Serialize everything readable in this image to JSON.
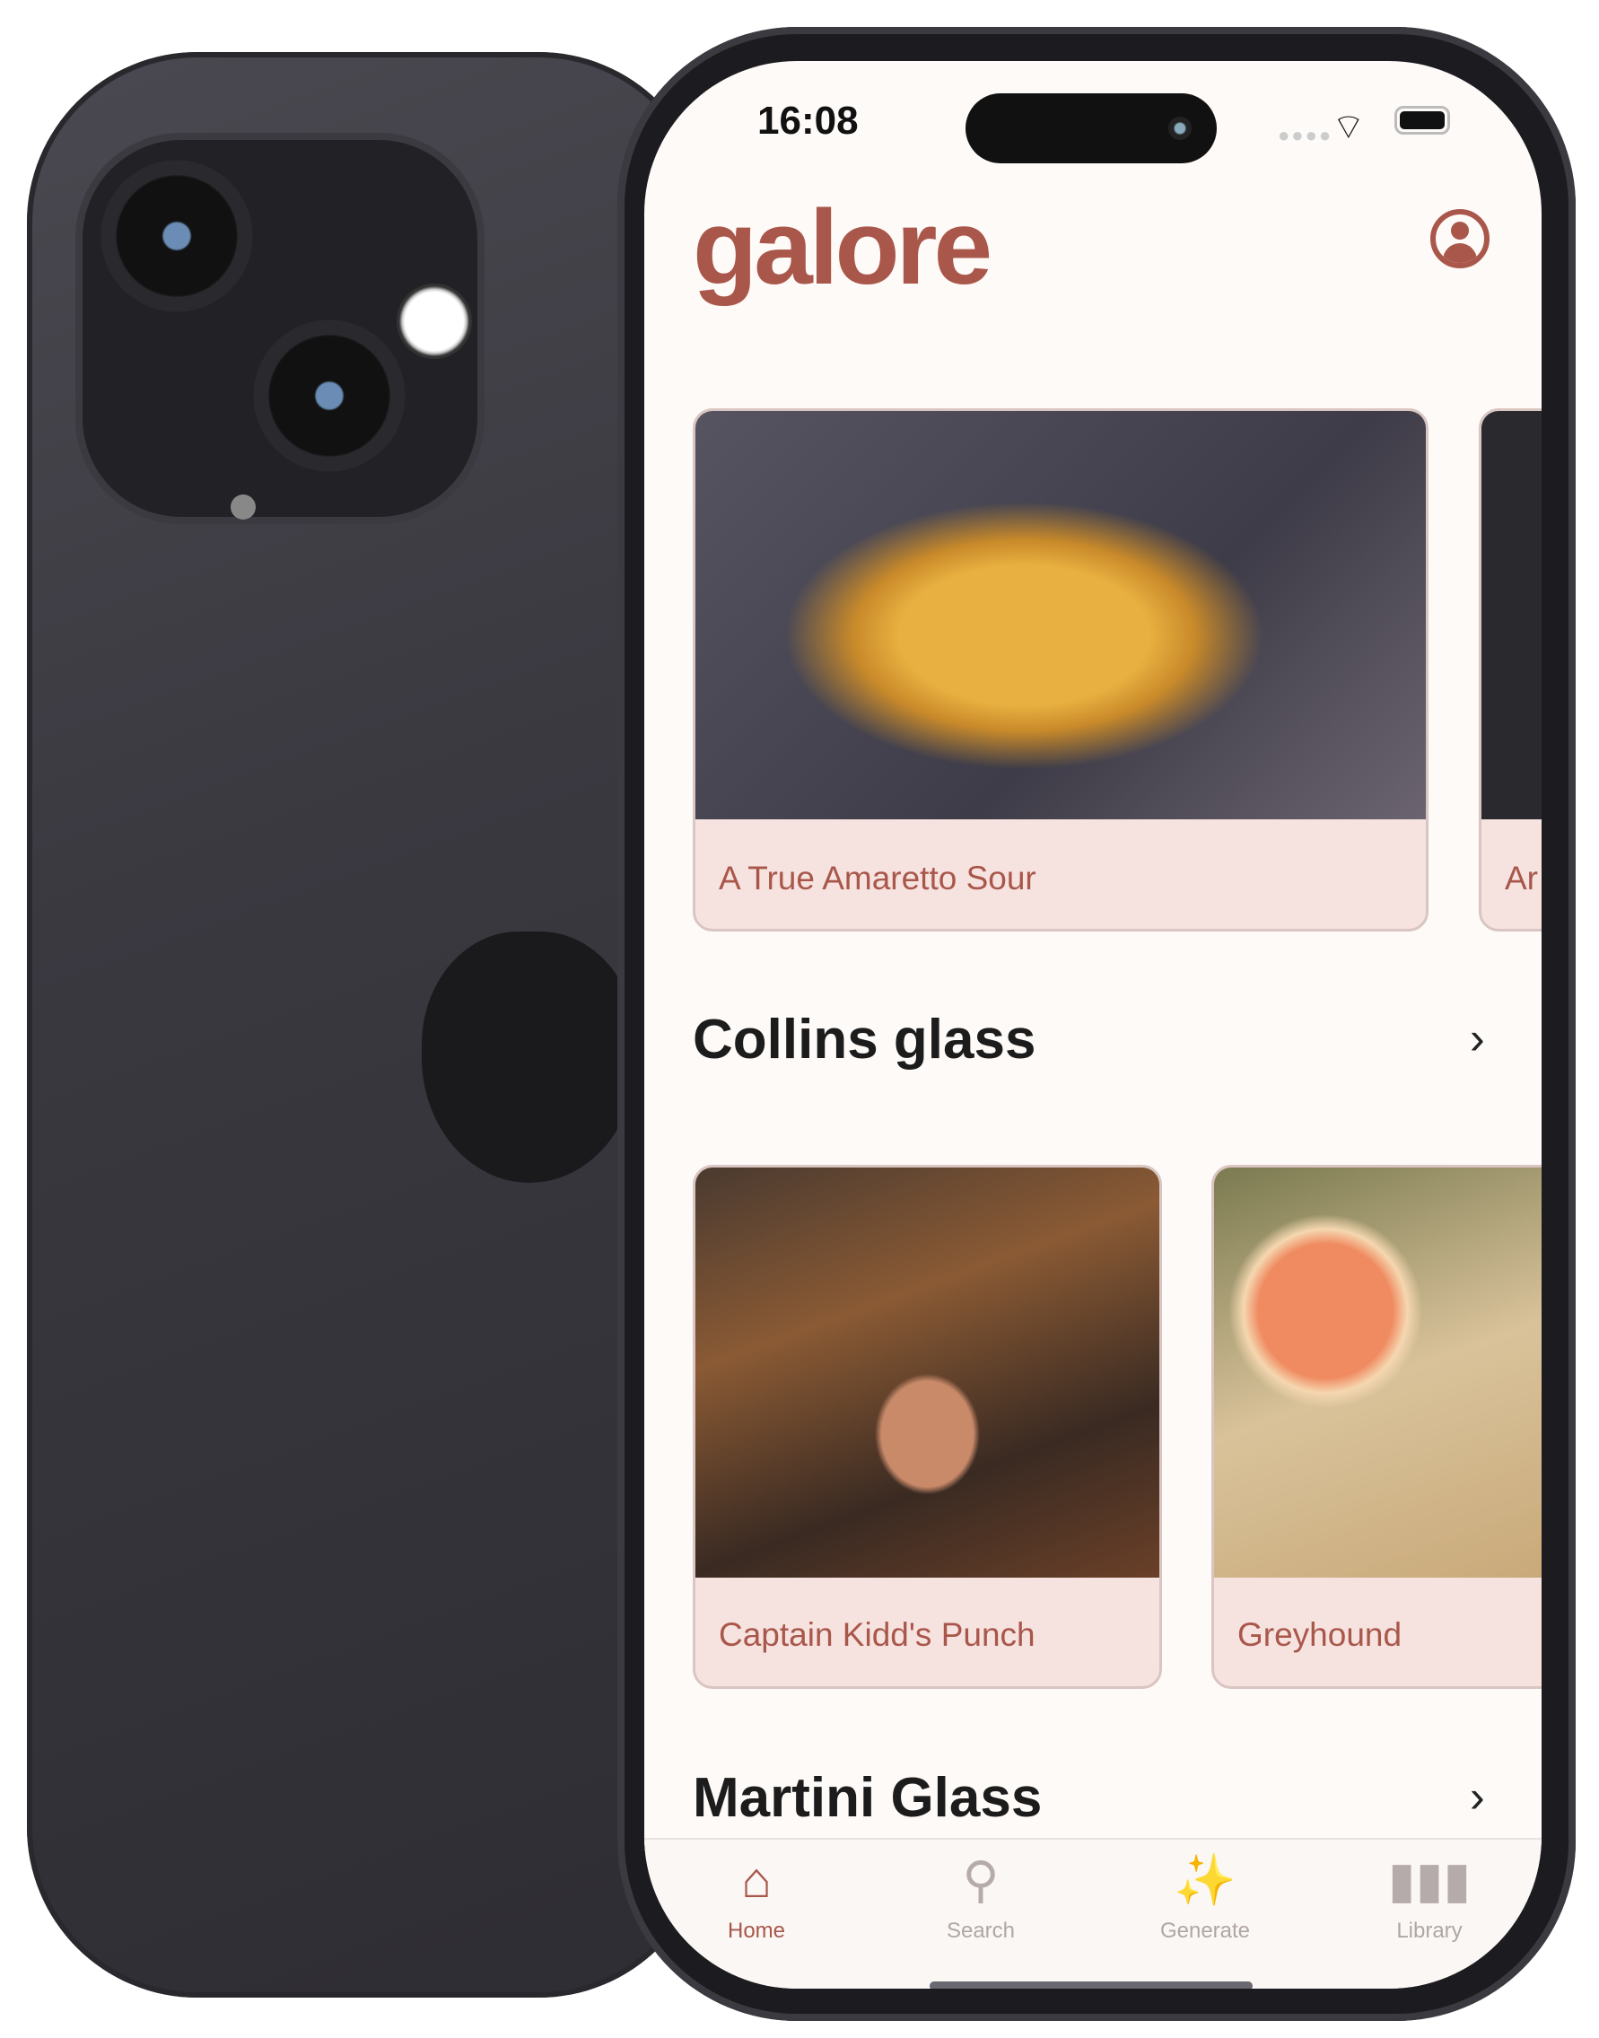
{
  "status_bar": {
    "time": "16:08"
  },
  "header": {
    "logo": "galore",
    "profile_icon": "person-circle-icon"
  },
  "featured": {
    "cards": [
      {
        "title": "A True Amaretto Sour"
      },
      {
        "title": "Ar"
      }
    ]
  },
  "sections": [
    {
      "title": "Collins glass",
      "cards": [
        {
          "title": "Captain Kidd's Punch"
        },
        {
          "title": "Greyhound"
        }
      ]
    },
    {
      "title": "Martini Glass"
    }
  ],
  "tabbar": {
    "items": [
      {
        "label": "Home",
        "icon": "house-icon",
        "active": true
      },
      {
        "label": "Search",
        "icon": "magnifier-icon",
        "active": false
      },
      {
        "label": "Generate",
        "icon": "magic-wand-icon",
        "active": false
      },
      {
        "label": "Library",
        "icon": "books-icon",
        "active": false
      }
    ]
  },
  "colors": {
    "accent": "#a9574a",
    "card_bg": "#f6e3e0",
    "background": "#fdfaf8",
    "inactive": "#b5abaa"
  }
}
